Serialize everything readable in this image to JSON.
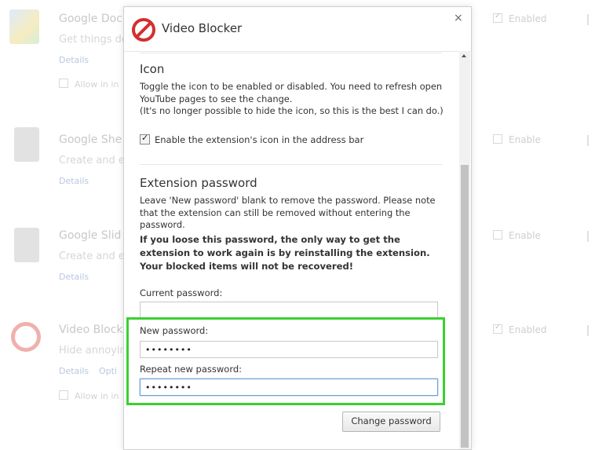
{
  "background_list": [
    {
      "name": "Google Doc",
      "desc": "Get things do",
      "link": "Details",
      "allow": "Allow in in",
      "enable": "Enabled",
      "enable_checked": true,
      "icon": "docs-icon",
      "color": "#4a86e8"
    },
    {
      "name": "Google She",
      "desc": "Create and e",
      "link": "Details",
      "enable": "Enable",
      "enable_checked": false,
      "icon": "sheets-icon",
      "color": "#9e9e9e"
    },
    {
      "name": "Google Slid",
      "desc": "Create and e",
      "link": "Details",
      "enable": "Enable",
      "enable_checked": false,
      "icon": "slides-icon",
      "color": "#9e9e9e"
    },
    {
      "name": "Video Block",
      "desc": "Hide annoyin",
      "link": "Details",
      "link2": "Opti",
      "allow": "Allow in in",
      "enable": "Enabled",
      "enable_checked": true,
      "icon": "block-icon",
      "color": "#e57373"
    }
  ],
  "dialog": {
    "title": "Video Blocker",
    "close": "×",
    "icon_section": {
      "title": "Icon",
      "text1": "Toggle the icon to be enabled or disabled. You need to refresh open YouTube pages to see the change.",
      "text2": "(It's no longer possible to hide the icon, so this is the best I can do.)",
      "checkbox_label": "Enable the extension's icon in the address bar"
    },
    "password_section": {
      "title": "Extension password",
      "text": "Leave 'New password' blank to remove the password. Please note that the extension can still be removed without entering the password.",
      "warning": "If you loose this password, the only way to get the extension to work again is by reinstalling the extension. Your blocked items will not be recovered!",
      "current_label": "Current password:",
      "current_value": "",
      "new_label": "New password:",
      "new_value": "••••••••",
      "repeat_label": "Repeat new password:",
      "repeat_value": "••••••••",
      "button": "Change password"
    }
  },
  "colors": {
    "accent_red": "#d32f2f",
    "highlight": "#39d12f",
    "link": "#3b6cc4"
  }
}
